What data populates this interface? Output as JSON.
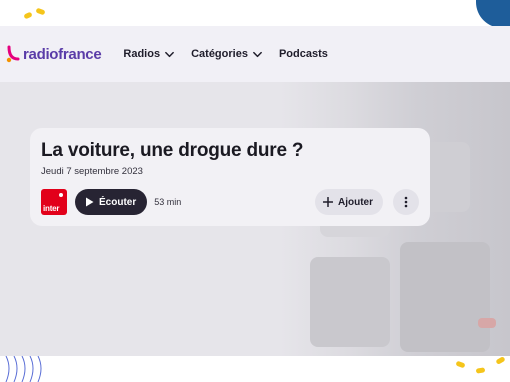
{
  "brand": {
    "name": "radiofrance"
  },
  "nav": [
    {
      "label": "Radios",
      "dropdown": true
    },
    {
      "label": "Catégories",
      "dropdown": true
    },
    {
      "label": "Podcasts",
      "dropdown": false
    }
  ],
  "episode": {
    "title": "La voiture, une drogue dure ?",
    "date": "Jeudi 7 septembre 2023",
    "station_logo_text": "inter",
    "listen_label": "Écouter",
    "duration": "53 min",
    "add_label": "Ajouter"
  },
  "icons": {
    "brand_logo": "radiofrance-logo-icon",
    "nav_chevron": "chevron-down-icon",
    "play": "play-icon",
    "plus": "plus-icon",
    "more": "more-vertical-icon"
  },
  "colors": {
    "brand_purple": "#5a3ca8",
    "brand_pink": "#e5007e",
    "brand_orange": "#f39200",
    "inter_red": "#e2001a",
    "button_dark": "#272433",
    "header_bg": "#f1f0f6",
    "accent_yellow": "#f5c51b",
    "accent_blue": "#1e5d9a"
  }
}
